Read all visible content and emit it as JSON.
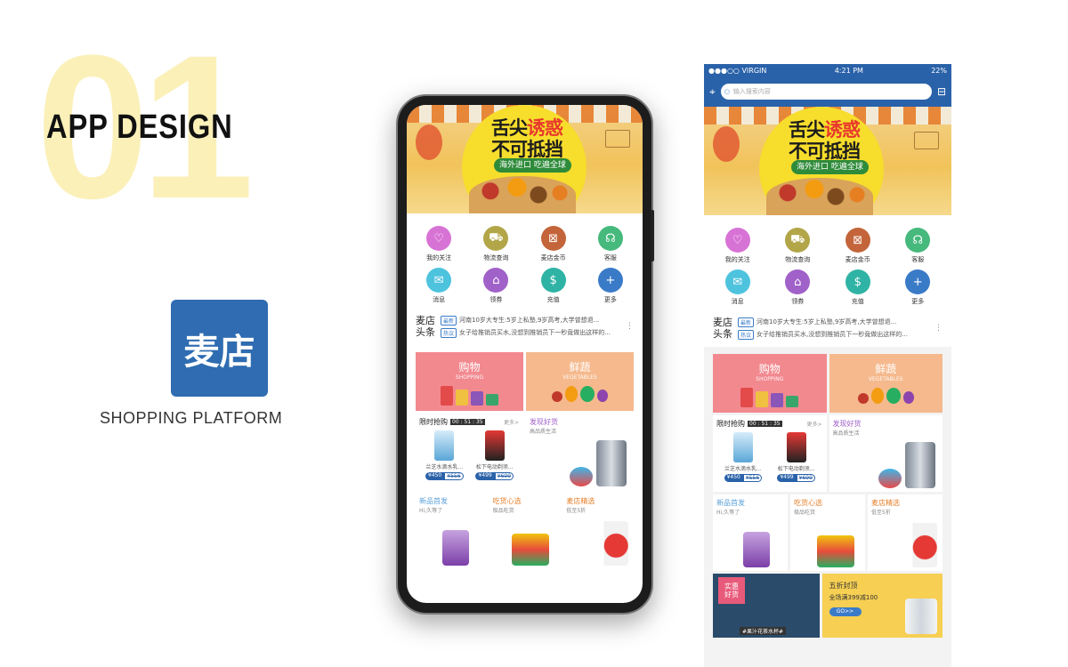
{
  "branding": {
    "number": "01",
    "title": "APP DESIGN",
    "logo_text": "麦店",
    "platform": "SHOPPING PLATFORM"
  },
  "status_bar": {
    "carrier": "●●●○○ VIRGIN",
    "time": "4:21 PM",
    "battery": "22%"
  },
  "search": {
    "placeholder": "输入搜索内容"
  },
  "banner": {
    "line1_a": "舌尖",
    "line1_b": "诱惑",
    "line2_a": "不可抵",
    "line2_b": "挡",
    "tag": "海外进口 吃遍全球"
  },
  "icons": [
    {
      "label": "我的关注",
      "icon": "heart-icon",
      "color": "#d873d6"
    },
    {
      "label": "物流查询",
      "icon": "truck-icon",
      "color": "#b2a648"
    },
    {
      "label": "麦店金币",
      "icon": "coin-icon",
      "color": "#c3643a"
    },
    {
      "label": "客服",
      "icon": "headset-icon",
      "color": "#46b97c"
    },
    {
      "label": "消息",
      "icon": "message-icon",
      "color": "#4ec3de"
    },
    {
      "label": "领券",
      "icon": "tag-icon",
      "color": "#a061c9"
    },
    {
      "label": "充值",
      "icon": "dollar-icon",
      "color": "#2fb3a4"
    },
    {
      "label": "更多",
      "icon": "plus-icon",
      "color": "#3a7bc8"
    }
  ],
  "headlines": {
    "brand1": "麦店",
    "brand2": "头条",
    "items": [
      {
        "tag": "最新",
        "text": "河南10岁大专生:5岁上私塾,9岁高考,大学曾想退..."
      },
      {
        "tag": "热议",
        "text": "女子给推销员买水,没想到推销员下一秒竟做出这样的..."
      }
    ],
    "more": "⋮"
  },
  "categories": [
    {
      "title": "购物",
      "subtitle": "SHOPPING"
    },
    {
      "title": "鲜蔬",
      "subtitle": "VEGETABLES"
    }
  ],
  "flash_sale": {
    "title": "限时抢购",
    "timer": "00 : 51 : 35",
    "more": "更多>",
    "products": [
      {
        "name": "兰芝水滴水乳...",
        "price": "¥450",
        "old_price": "¥556"
      },
      {
        "name": "松下电动剃须...",
        "price": "¥499",
        "old_price": "¥699"
      }
    ]
  },
  "discover": {
    "title": "发现好货",
    "subtitle": "高品质生活"
  },
  "small_tiles": [
    {
      "title": "新品首发",
      "subtitle": "Hi,久等了",
      "color": "#5aa0d8"
    },
    {
      "title": "吃货心选",
      "subtitle": "极品吃货",
      "color": "#e6812c"
    },
    {
      "title": "麦店精选",
      "subtitle": "低至5折",
      "color": "#e6812c"
    }
  ],
  "promo": {
    "left_tag_1": "实惠",
    "left_tag_2": "好货",
    "left_caption": "#果汁花茶水杯#",
    "right_t1": "五折封顶",
    "right_t2": "全场满399减100",
    "right_btn": "GO>>"
  }
}
